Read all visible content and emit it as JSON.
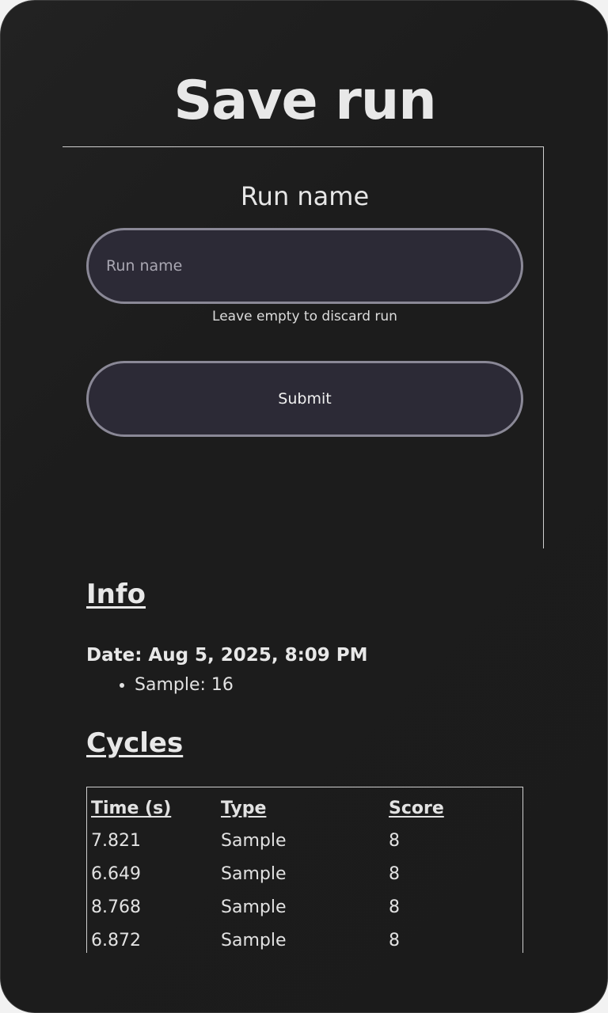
{
  "page": {
    "title": "Save run"
  },
  "form": {
    "field_label": "Run name",
    "input_placeholder": "Run name",
    "input_value": "",
    "hint": "Leave empty to discard run",
    "submit_label": "Submit"
  },
  "info": {
    "heading": "Info",
    "date_line": "Date: Aug 5, 2025, 8:09 PM",
    "items": [
      "Sample: 16"
    ]
  },
  "cycles": {
    "heading": "Cycles",
    "columns": [
      "Time (s)",
      "Type",
      "Score"
    ],
    "rows": [
      [
        "7.821",
        "Sample",
        "8"
      ],
      [
        "6.649",
        "Sample",
        "8"
      ],
      [
        "8.768",
        "Sample",
        "8"
      ],
      [
        "6.872",
        "Sample",
        "8"
      ]
    ]
  },
  "colors": {
    "background": "#1c1c1c",
    "control_fill": "#2c2a36",
    "control_border": "#8a8896",
    "text": "#e6e6e6"
  }
}
